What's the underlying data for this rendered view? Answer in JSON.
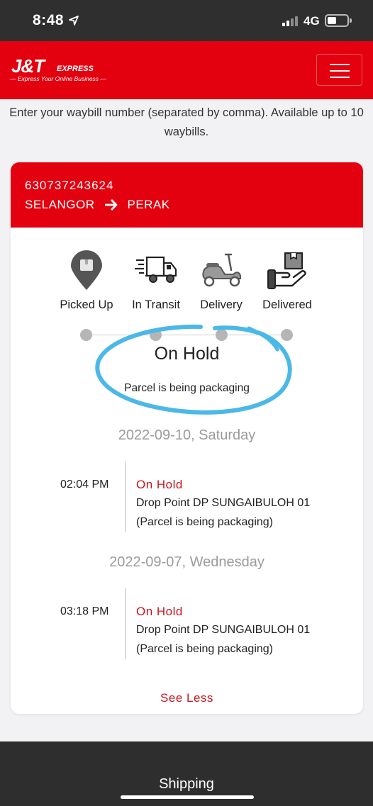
{
  "status_bar": {
    "time": "8:48",
    "network": "4G"
  },
  "header": {
    "logo_main": "J&T",
    "logo_sub": "EXPRESS",
    "logo_tagline": "— Express Your Online Business —"
  },
  "instructions": "Enter your waybill number (separated by comma). Available up to 10 waybills.",
  "card": {
    "waybill": "630737243624",
    "origin": "SELANGOR",
    "destination": "PERAK",
    "stages": [
      {
        "label": "Picked Up",
        "icon": "pin-box-icon"
      },
      {
        "label": "In Transit",
        "icon": "truck-icon"
      },
      {
        "label": "Delivery",
        "icon": "scooter-icon"
      },
      {
        "label": "Delivered",
        "icon": "hand-box-icon"
      }
    ],
    "current_status": "On Hold",
    "current_desc": "Parcel is being packaging",
    "groups": [
      {
        "date": "2022-09-10, Saturday",
        "events": [
          {
            "time": "02:04 PM",
            "status": "On Hold",
            "location": "Drop Point DP SUNGAIBULOH 01",
            "note": "(Parcel is being packaging)"
          }
        ]
      },
      {
        "date": "2022-09-07, Wednesday",
        "events": [
          {
            "time": "03:18 PM",
            "status": "On Hold",
            "location": "Drop Point DP SUNGAIBULOH 01",
            "note": "(Parcel is being packaging)"
          }
        ]
      }
    ],
    "see_less": "See Less"
  },
  "footer": {
    "label": "Shipping"
  },
  "colors": {
    "brand_red": "#e3000f",
    "status_red": "#c8161d",
    "highlight": "#4bb8e8"
  }
}
